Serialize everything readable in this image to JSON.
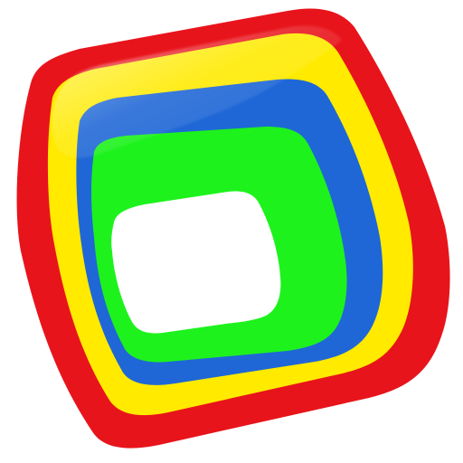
{
  "icon": {
    "name": "app-icon",
    "layers": [
      {
        "name": "red-layer",
        "color": "#e8141b"
      },
      {
        "name": "yellow-layer",
        "color": "#ffea00"
      },
      {
        "name": "blue-layer",
        "color": "#1f67d6"
      },
      {
        "name": "green-layer",
        "color": "#1df21d"
      },
      {
        "name": "white-center",
        "color": "#ffffff"
      }
    ]
  }
}
